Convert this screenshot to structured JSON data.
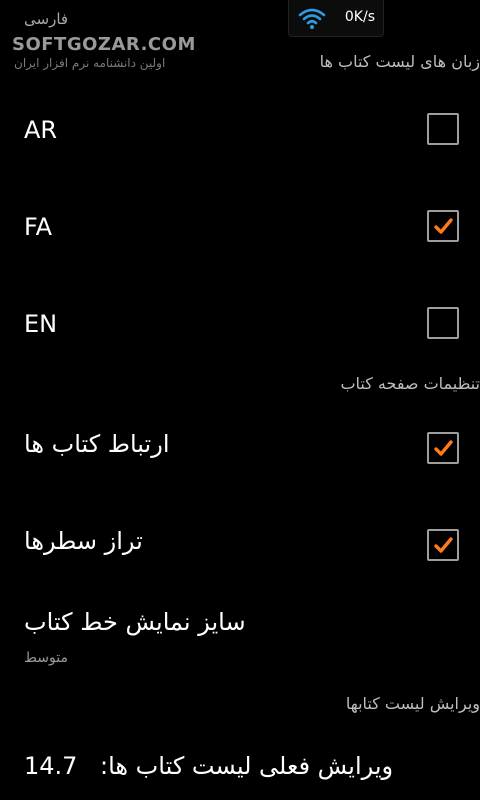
{
  "status": {
    "wifi_icon": "wifi-icon",
    "speed": "0K/s"
  },
  "prev": {
    "summary": "فارسی"
  },
  "watermark": {
    "title": "SOFTGOZAR.COM",
    "subtitle": "اولین دانشنامه نرم افزار ایران"
  },
  "sections": {
    "languages": "زبان های لیست کتاب ها",
    "book_settings": "تنظیمات صفحه کتاب",
    "list_edit": "ویرایش لیست کتابها"
  },
  "languages": [
    {
      "label": "AR",
      "checked": false
    },
    {
      "label": "FA",
      "checked": true
    },
    {
      "label": "EN",
      "checked": false
    }
  ],
  "book_settings": {
    "link_books": {
      "label": "ارتباط کتاب ها",
      "checked": true
    },
    "justify_lines": {
      "label": "تراز سطرها",
      "checked": true
    },
    "font_size": {
      "label": "سایز نمایش خط کتاب",
      "value": "متوسط"
    }
  },
  "list_edit": {
    "current_label": "ویرایش فعلی لیست کتاب ها:",
    "current_value": "14.7"
  },
  "colors": {
    "accent": "#ff7a1a",
    "background": "#000000"
  }
}
